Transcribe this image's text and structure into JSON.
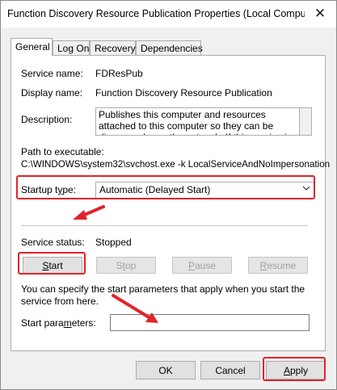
{
  "window": {
    "title": "Function Discovery Resource Publication Properties (Local Comput...",
    "close_glyph": "✕"
  },
  "tabs": [
    {
      "label": "General",
      "active": true
    },
    {
      "label": "Log On",
      "active": false
    },
    {
      "label": "Recovery",
      "active": false
    },
    {
      "label": "Dependencies",
      "active": false
    }
  ],
  "general": {
    "service_name_label": "Service name:",
    "service_name_value": "FDResPub",
    "display_name_label": "Display name:",
    "display_name_value": "Function Discovery Resource Publication",
    "description_label": "Description:",
    "description_value": "Publishes this computer and resources attached to this computer so they can be discovered over the network.  If this service is stopped, network",
    "path_label": "Path to executable:",
    "path_value": "C:\\WINDOWS\\system32\\svchost.exe -k LocalServiceAndNoImpersonation",
    "startup_type_label": "Startup type:",
    "startup_type_value": "Automatic (Delayed Start)",
    "service_status_label": "Service status:",
    "service_status_value": "Stopped",
    "buttons": {
      "start": "Start",
      "stop": "Stop",
      "pause": "Pause",
      "resume": "Resume"
    },
    "info_text": "You can specify the start parameters that apply when you start the service from here.",
    "start_params_label": "Start parameters:",
    "start_params_value": ""
  },
  "footer": {
    "ok": "OK",
    "cancel": "Cancel",
    "apply": "Apply"
  },
  "colors": {
    "highlight": "#e0242d",
    "window_bg": "#f0f0f0"
  }
}
